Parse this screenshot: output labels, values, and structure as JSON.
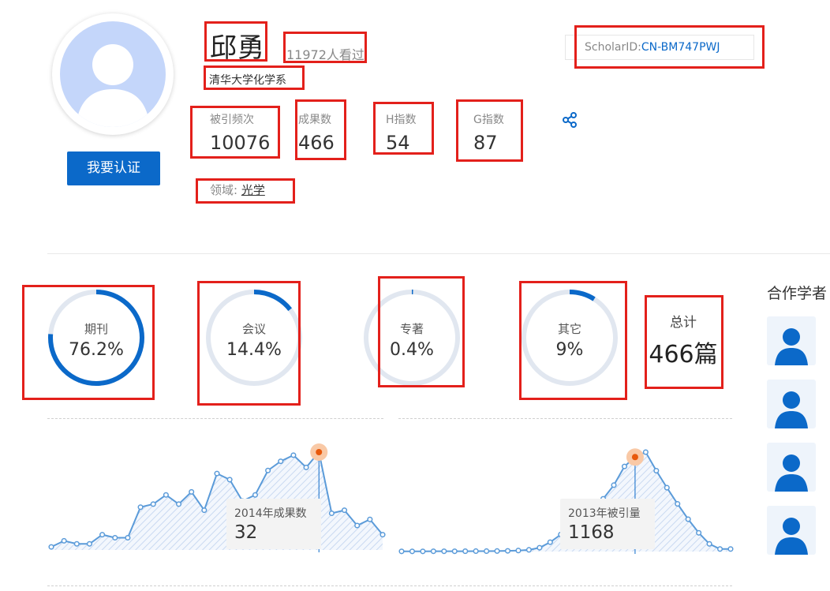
{
  "profile": {
    "name": "邱勇",
    "views": "11972人看过",
    "department": "清华大学化学系",
    "verify_button": "我要认证",
    "scholar_id_label": "ScholarID:",
    "scholar_id_value": "CN-BM747PWJ"
  },
  "metrics": [
    {
      "label": "被引频次",
      "value": "10076"
    },
    {
      "label": "成果数",
      "value": "466"
    },
    {
      "label": "H指数",
      "value": "54"
    },
    {
      "label": "G指数",
      "value": "87"
    }
  ],
  "field": {
    "label": "领域:",
    "value": "光学"
  },
  "distribution": [
    {
      "label": "期刊",
      "percent_text": "76.2%",
      "percent": 76.2
    },
    {
      "label": "会议",
      "percent_text": "14.4%",
      "percent": 14.4
    },
    {
      "label": "专著",
      "percent_text": "0.4%",
      "percent": 0.4
    },
    {
      "label": "其它",
      "percent_text": "9%",
      "percent": 9
    }
  ],
  "total": {
    "label": "总计",
    "value": "466篇"
  },
  "coauthors": {
    "title": "合作学者"
  },
  "colors": {
    "accent": "#0b69c9",
    "ring_track": "#e1e7f0",
    "highlight": "#e3201b",
    "peak": "#e8590c"
  },
  "chart_data": [
    {
      "type": "area",
      "title": "",
      "tooltip_label": "2014年成果数",
      "tooltip_value": "32",
      "highlight_index": 21,
      "values": [
        1,
        3,
        2,
        2,
        5,
        4,
        4,
        14,
        15,
        18,
        15,
        19,
        13,
        25,
        23,
        16,
        18,
        26,
        29,
        31,
        27,
        32,
        12,
        13,
        8,
        10,
        5
      ]
    },
    {
      "type": "area",
      "title": "",
      "tooltip_label": "2013年被引量",
      "tooltip_value": "1168",
      "highlight_index": 22,
      "values": [
        2,
        2,
        2,
        3,
        3,
        3,
        4,
        5,
        5,
        6,
        8,
        12,
        20,
        45,
        110,
        200,
        280,
        360,
        480,
        620,
        780,
        1000,
        1110,
        1168,
        950,
        750,
        560,
        380,
        220,
        90,
        30,
        30
      ]
    }
  ]
}
